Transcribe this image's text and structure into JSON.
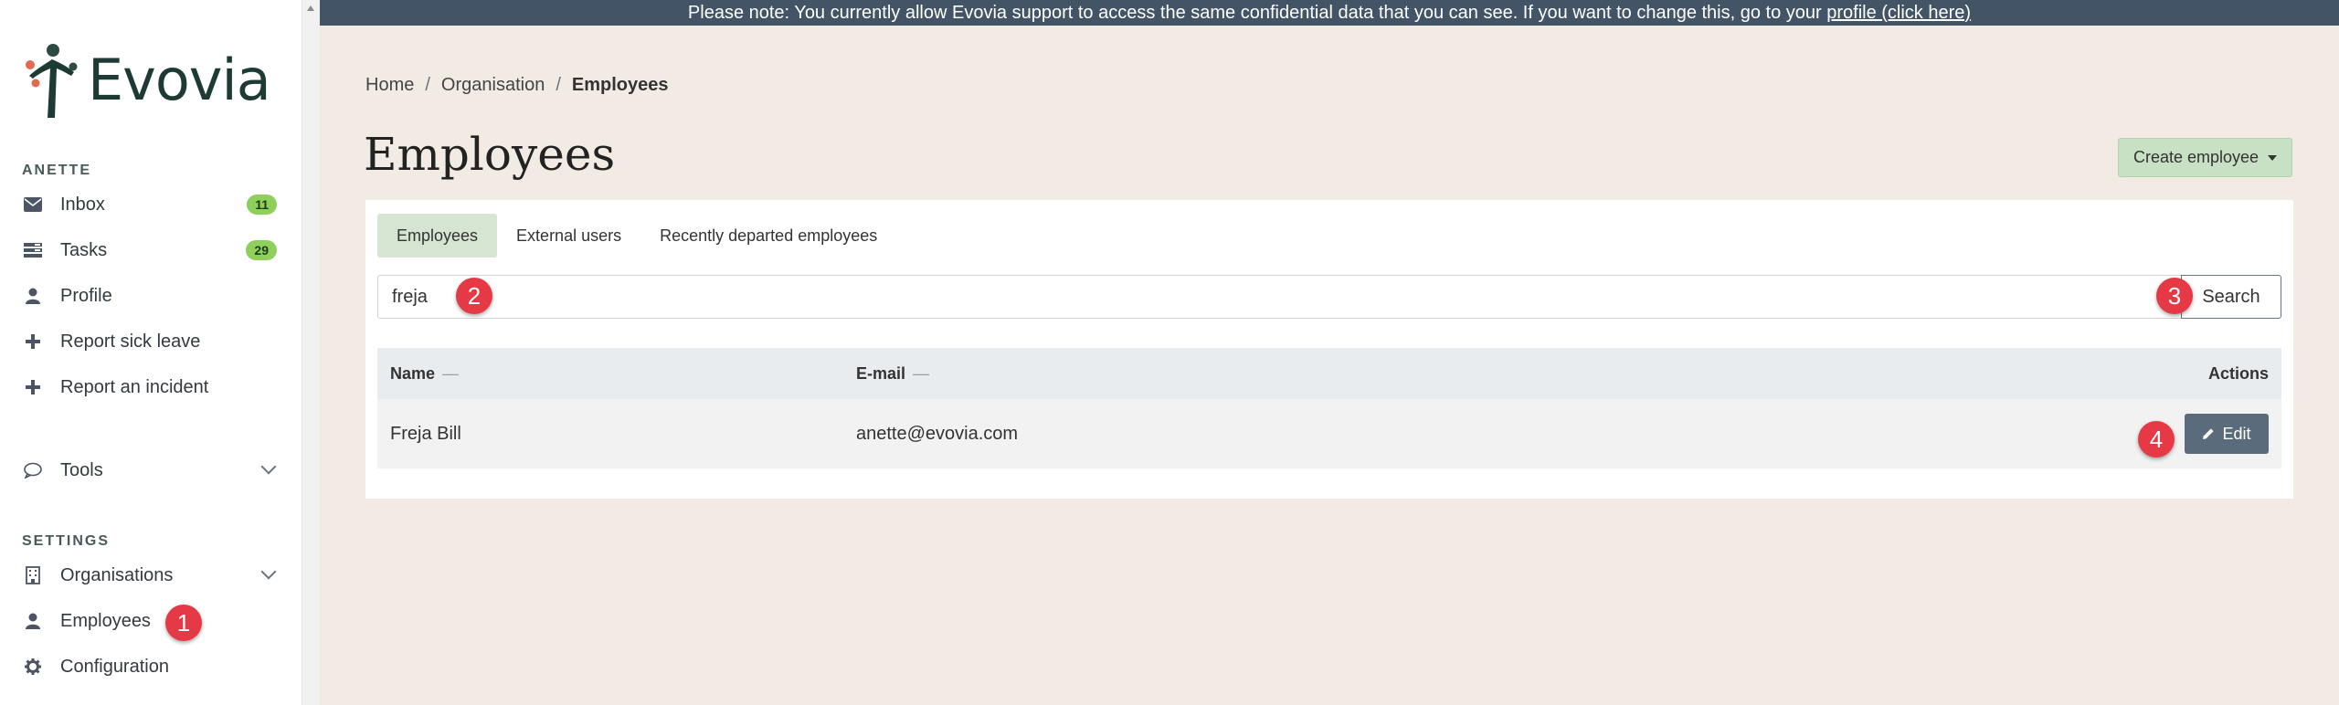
{
  "app": {
    "name": "Evovia"
  },
  "banner": {
    "text": "Please note: You currently allow Evovia support to access the same confidential data that you can see. If you want to change this, go to your ",
    "link": "profile (click here)"
  },
  "sidebar": {
    "user_section": "ANETTE",
    "items": [
      {
        "label": "Inbox",
        "icon": "envelope-icon",
        "badge": "11"
      },
      {
        "label": "Tasks",
        "icon": "tasks-icon",
        "badge": "29"
      },
      {
        "label": "Profile",
        "icon": "user-icon"
      },
      {
        "label": "Report sick leave",
        "icon": "plus-icon"
      },
      {
        "label": "Report an incident",
        "icon": "plus-icon"
      }
    ],
    "tools": {
      "label": "Tools",
      "icon": "speech-bubble-icon"
    },
    "settings_section": "SETTINGS",
    "settings_items": [
      {
        "label": "Organisations",
        "icon": "building-icon"
      },
      {
        "label": "Employees",
        "icon": "user-icon"
      },
      {
        "label": "Configuration",
        "icon": "gear-icon"
      }
    ]
  },
  "breadcrumb": {
    "items": [
      "Home",
      "Organisation",
      "Employees"
    ]
  },
  "page": {
    "title": "Employees",
    "create_button": "Create employee"
  },
  "tabs": [
    "Employees",
    "External users",
    "Recently departed employees"
  ],
  "search": {
    "value": "freja",
    "button": "Search"
  },
  "table": {
    "headers": {
      "name": "Name",
      "email": "E-mail",
      "actions": "Actions"
    },
    "sort_indicator": "—",
    "rows": [
      {
        "name": "Freja Bill",
        "email": "anette@evovia.com",
        "action": "Edit"
      }
    ]
  },
  "callouts": [
    "1",
    "2",
    "3",
    "4"
  ],
  "colors": {
    "accent_green": "#8fcf5c",
    "banner_bg": "#425466",
    "callout": "#e53945",
    "edit_button": "#5a6b7b"
  }
}
